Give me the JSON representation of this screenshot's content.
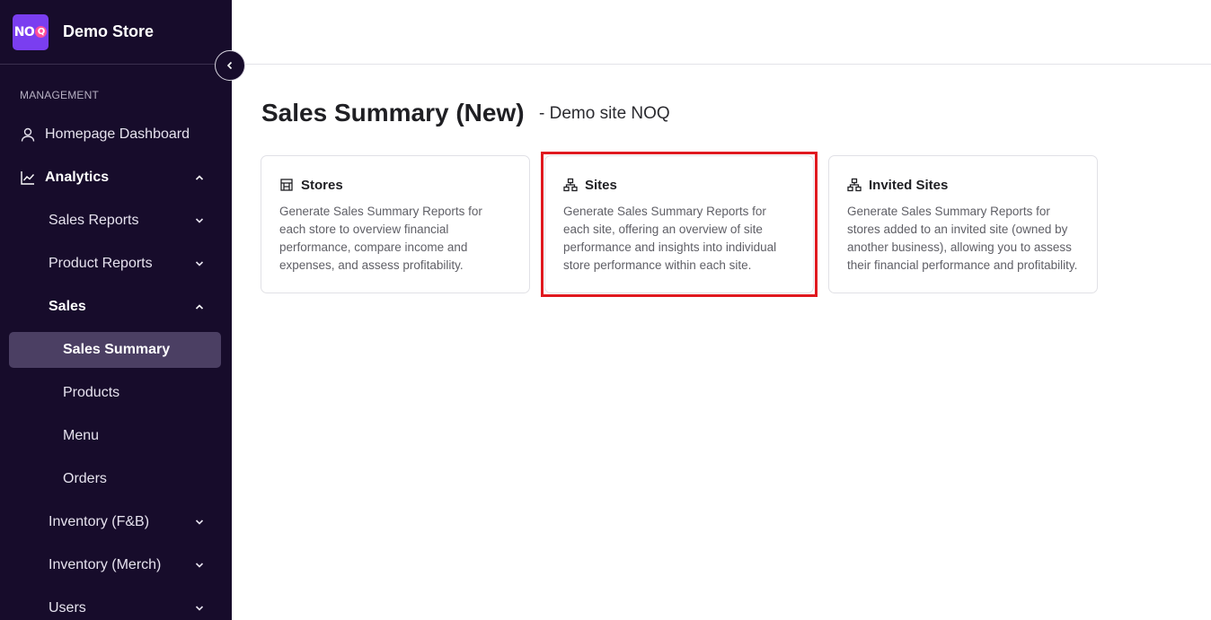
{
  "brand": {
    "logo_text": "NO",
    "logo_q": "Q",
    "store_name": "Demo Store"
  },
  "sidebar": {
    "section_label": "MANAGEMENT",
    "items": [
      {
        "label": "Homepage Dashboard",
        "icon": "user-icon"
      },
      {
        "label": "Analytics",
        "icon": "chart-line-icon",
        "expanded": true
      },
      {
        "label": "Sales Reports",
        "expanded": false
      },
      {
        "label": "Product Reports",
        "expanded": false
      },
      {
        "label": "Sales",
        "expanded": true
      },
      {
        "label": "Sales Summary",
        "active": true
      },
      {
        "label": "Products"
      },
      {
        "label": "Menu"
      },
      {
        "label": "Orders"
      },
      {
        "label": "Inventory (F&B)",
        "expanded": false
      },
      {
        "label": "Inventory (Merch)",
        "expanded": false
      },
      {
        "label": "Users",
        "expanded": false
      }
    ]
  },
  "main": {
    "title": "Sales Summary (New)",
    "subtitle": "- Demo site NOQ",
    "cards": [
      {
        "title": "Stores",
        "icon": "store-icon",
        "description": "Generate Sales Summary Reports for each store to overview financial performance, compare income and expenses, and assess profitability."
      },
      {
        "title": "Sites",
        "icon": "sitemap-icon",
        "description": "Generate Sales Summary Reports for each site, offering an overview of site performance and insights into individual store performance within each site."
      },
      {
        "title": "Invited Sites",
        "icon": "sitemap-icon",
        "description": "Generate Sales Summary Reports for stores added to an invited site (owned by another business), allowing you to assess their financial performance and profitability."
      }
    ]
  },
  "colors": {
    "sidebar_bg": "#170c2b",
    "active_item_bg": "#4b3f63",
    "brand_purple": "#7a3ef0",
    "highlight_red": "#e0191f"
  }
}
